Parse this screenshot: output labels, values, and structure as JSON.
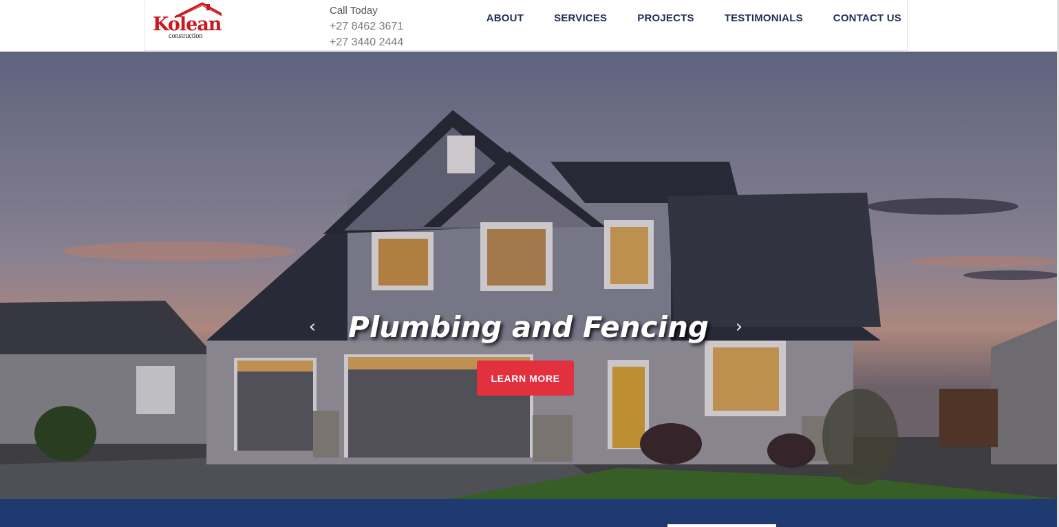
{
  "brand": {
    "name": "Kolean",
    "tagline": "construction",
    "primary_color": "#c8191f",
    "icon": "house-roof-icon"
  },
  "contact": {
    "call_label": "Call Today",
    "phones": [
      "+27 8462 3671",
      "+27 3440 2444"
    ]
  },
  "nav": {
    "items": [
      {
        "label": "ABOUT"
      },
      {
        "label": "SERVICES"
      },
      {
        "label": "PROJECTS"
      },
      {
        "label": "TESTIMONIALS"
      },
      {
        "label": "CONTACT US"
      }
    ],
    "color": "#1f2f56"
  },
  "hero": {
    "title": "Plumbing and Fencing",
    "button_label": "LEARN MORE",
    "button_color": "#e3303f",
    "prev_icon": "chevron-left-icon",
    "next_icon": "chevron-right-icon",
    "prev_glyph": "‹",
    "next_glyph": "›"
  },
  "footer": {
    "band_color": "#1f3a70"
  }
}
